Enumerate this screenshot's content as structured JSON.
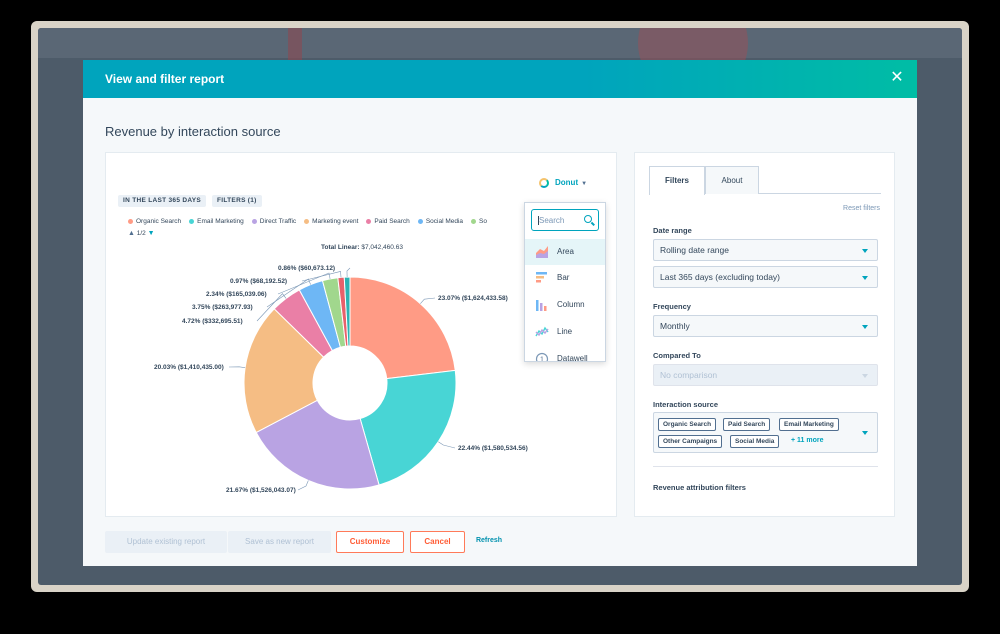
{
  "modal": {
    "title": "View and filter report",
    "close_icon": "close-icon"
  },
  "report": {
    "title": "Revenue by interaction source"
  },
  "chart_panel": {
    "pills": [
      "IN THE LAST 365 DAYS",
      "FILTERS (1)"
    ],
    "chart_type_label": "Donut",
    "legend_page": "1/2",
    "total_label": "Total Linear:",
    "total_value": "$7,042,460.63"
  },
  "chart_type_menu": {
    "search_placeholder": "Search",
    "items": [
      {
        "label": "Area",
        "icon": "area-chart-icon",
        "active": true
      },
      {
        "label": "Bar",
        "icon": "bar-chart-icon",
        "active": false
      },
      {
        "label": "Column",
        "icon": "column-chart-icon",
        "active": false
      },
      {
        "label": "Line",
        "icon": "line-chart-icon",
        "active": false
      },
      {
        "label": "Datawell",
        "icon": "datawell-icon",
        "active": false
      }
    ]
  },
  "chart_data": {
    "type": "pie",
    "variant": "donut",
    "title": "Total Linear: $7,042,460.63",
    "legend_placement": "top",
    "series": [
      {
        "name": "Organic Search",
        "value": 1624433.58,
        "percent": 23.07,
        "label": "23.07% ($1,624,433.58)",
        "color": "#ff9b85"
      },
      {
        "name": "Email Marketing",
        "value": 1580534.56,
        "percent": 22.44,
        "label": "22.44% ($1,580,534.56)",
        "color": "#48d5d5"
      },
      {
        "name": "Direct Traffic",
        "value": 1526043.07,
        "percent": 21.67,
        "label": "21.67% ($1,526,043.07)",
        "color": "#b9a3e3"
      },
      {
        "name": "Marketing event",
        "value": 1410435.0,
        "percent": 20.03,
        "label": "20.03% ($1,410,435.00)",
        "color": "#f5bd84"
      },
      {
        "name": "Paid Search",
        "value": 332695.51,
        "percent": 4.72,
        "label": "4.72% ($332,695.51)",
        "color": "#ea7fa6"
      },
      {
        "name": "Social Media",
        "value": 263977.93,
        "percent": 3.75,
        "label": "3.75% ($263,977.93)",
        "color": "#6eb7f5"
      },
      {
        "name": "Social Media (cont.)",
        "value": 165039.06,
        "percent": 2.34,
        "label": "2.34% ($165,039.06)",
        "color": "#a1d78d"
      },
      {
        "name": "",
        "value": 68192.52,
        "percent": 0.97,
        "label": "0.97% ($68,192.52)",
        "color": "#e8616b"
      },
      {
        "name": "",
        "value": 60673.12,
        "percent": 0.86,
        "label": "0.86% ($60,673.12)",
        "color": "#2bb3b3"
      }
    ],
    "legend": [
      "Organic Search",
      "Email Marketing",
      "Direct Traffic",
      "Marketing event",
      "Paid Search",
      "Social Media",
      "So"
    ]
  },
  "filters_panel": {
    "tabs": [
      "Filters",
      "About"
    ],
    "reset_label": "Reset filters",
    "date_range_label": "Date range",
    "date_range_value": "Rolling date range",
    "date_period_value": "Last 365 days (excluding today)",
    "frequency_label": "Frequency",
    "frequency_value": "Monthly",
    "compared_label": "Compared To",
    "compared_value": "No comparison",
    "source_label": "Interaction source",
    "source_tags": [
      "Organic Search",
      "Paid Search",
      "Email Marketing",
      "Other Campaigns",
      "Social Media"
    ],
    "source_more": "+ 11 more",
    "attribution_label": "Revenue attribution filters"
  },
  "footer": {
    "update_label": "Update existing report",
    "save_label": "Save as new report",
    "customize_label": "Customize",
    "cancel_label": "Cancel",
    "refresh_label": "Refresh"
  },
  "colors": {
    "header_teal": "#00a4bd",
    "accent_orange": "#ff7a59",
    "link_teal": "#0091ae"
  }
}
